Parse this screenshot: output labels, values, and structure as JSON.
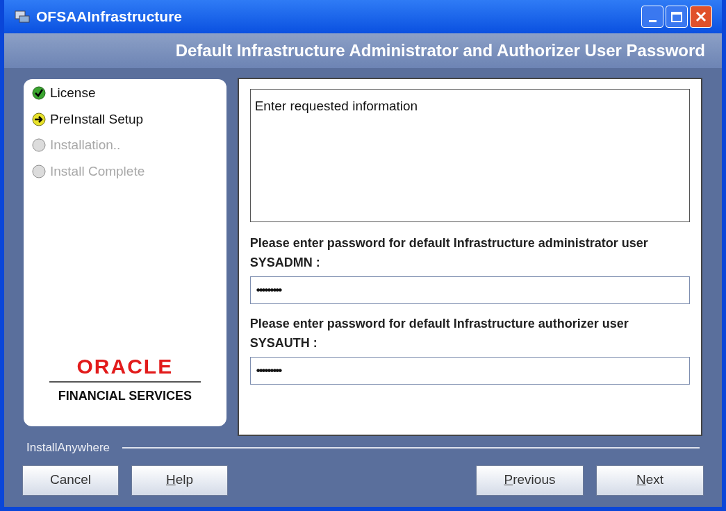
{
  "window": {
    "title": "OFSAAInfrastructure"
  },
  "header": {
    "title": "Default Infrastructure Administrator and Authorizer User Password"
  },
  "steps": [
    {
      "label": "License",
      "kind": "done"
    },
    {
      "label": "PreInstall Setup",
      "kind": "current"
    },
    {
      "label": "Installation..",
      "kind": "pending"
    },
    {
      "label": "Install Complete",
      "kind": "pending"
    }
  ],
  "logo": {
    "brand": "ORACLE",
    "subtitle": "FINANCIAL SERVICES"
  },
  "message": "Enter requested information",
  "fields": [
    {
      "label": "Please enter password for default Infrastructure administrator user SYSADMN :",
      "value": "•••••••••"
    },
    {
      "label": "Please enter password for default Infrastructure authorizer user SYSAUTH :",
      "value": "•••••••••"
    }
  ],
  "footer": {
    "vendor": "InstallAnywhere"
  },
  "buttons_left": [
    {
      "label": "Cancel",
      "underline_first": false
    },
    {
      "label": "Help",
      "underline_first": true
    }
  ],
  "buttons_right": [
    {
      "label": "Previous",
      "underline_first": true
    },
    {
      "label": "Next",
      "underline_first": true
    }
  ]
}
